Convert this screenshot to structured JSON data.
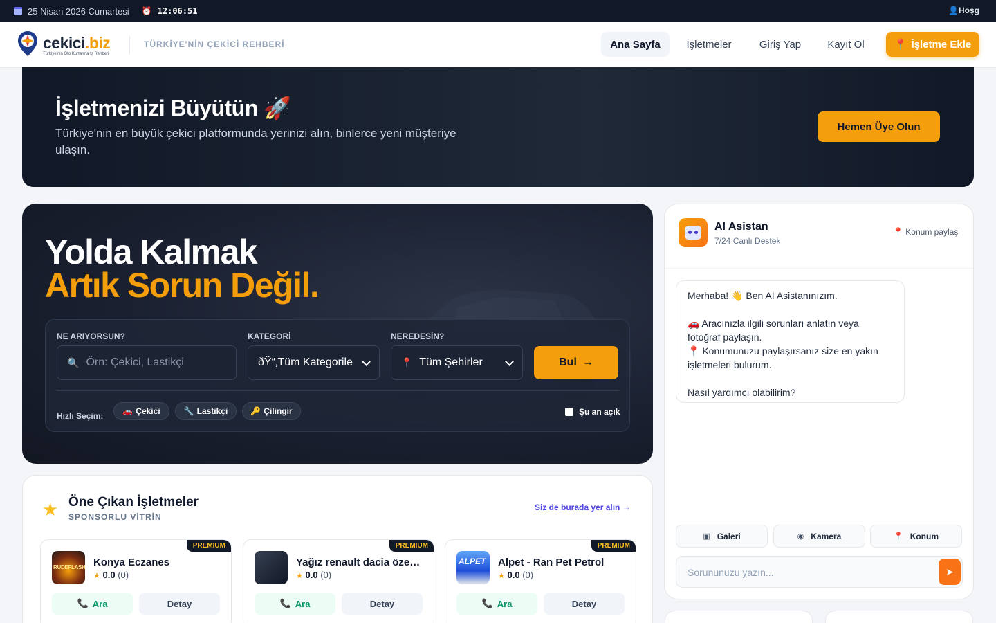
{
  "topbar": {
    "date": "25 Nisan 2026 Cumartesi",
    "time": "12:06:51",
    "greeting": "Hoşg"
  },
  "header": {
    "brand_main": "cekici",
    "brand_tld": ".biz",
    "brand_tagline": "Türkiye'nin Oto Kurtarma İş Rehberi",
    "slogan": "TÜRKİYE'NİN ÇEKİCİ REHBERİ",
    "nav": [
      "Ana Sayfa",
      "İşletmeler",
      "Giriş Yap",
      "Kayıt Ol"
    ],
    "cta": "İşletme Ekle"
  },
  "promo": {
    "title": "İşletmenizi Büyütün 🚀",
    "text": "Türkiye'nin en büyük çekici platformunda yerinizi alın, binlerce yeni müşteriye ulaşın.",
    "button": "Hemen Üye Olun"
  },
  "hero": {
    "line1": "Yolda Kalmak",
    "line2": "Artık Sorun Değil.",
    "search": {
      "what_label": "NE ARIYORSUN?",
      "what_placeholder": "Örn: Çekici, Lastikçi",
      "category_label": "KATEGORİ",
      "category_value": "ðŸ“‚Tüm Kategorile",
      "where_label": "NEREDESİN?",
      "where_value": "Tüm Şehirler",
      "find_button": "Bul",
      "quick_label": "Hızlı Seçim:",
      "chips": [
        {
          "icon": "🚗",
          "label": "Çekici"
        },
        {
          "icon": "🔧",
          "label": "Lastikçi"
        },
        {
          "icon": "🔑",
          "label": "Çilingir"
        }
      ],
      "open_now": "Şu an açık"
    }
  },
  "featured": {
    "title": "Öne Çıkan İşletmeler",
    "subtitle": "SPONSORLU VİTRİN",
    "cta": "Siz de burada yer alın →",
    "cards": [
      {
        "badge": "PREMIUM",
        "name": "Konya Eczanes",
        "rating": "0.0",
        "count": "(0)",
        "call": "Ara",
        "detail": "Detay",
        "thumb_text": "RUDEFLASH"
      },
      {
        "badge": "PREMIUM",
        "name": "Yağız renault dacia özel servisi",
        "rating": "0.0",
        "count": "(0)",
        "call": "Ara",
        "detail": "Detay"
      },
      {
        "badge": "PREMIUM",
        "name": "Alpet - Ran Pet Petrol",
        "rating": "0.0",
        "count": "(0)",
        "call": "Ara",
        "detail": "Detay",
        "thumb_text": "ALPET"
      }
    ]
  },
  "ai": {
    "title": "AI Asistan",
    "status": "7/24 Canlı Destek",
    "share_location": "Konum paylaş",
    "message": [
      "Merhaba! 👋 Ben AI Asistanınızım.",
      "",
      "🚗 Aracınızla ilgili sorunları anlatın veya fotoğraf paylaşın.",
      "📍 Konumunuzu paylaşırsanız size en yakın işletmeleri bulurum.",
      "",
      "Nasıl yardımcı olabilirim?"
    ],
    "buttons": [
      "Galeri",
      "Kamera",
      "Konum"
    ],
    "input_placeholder": "Sorununuzu yazın..."
  },
  "colors": {
    "accent": "#f59e0b",
    "dark": "#111827",
    "link": "#4f46e5",
    "call": "#059669"
  }
}
